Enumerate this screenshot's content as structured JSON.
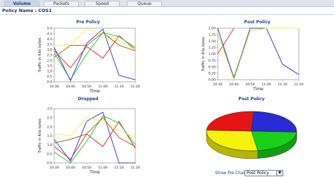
{
  "tabs": [
    {
      "label": "Volume",
      "active": true
    },
    {
      "label": "Packets",
      "active": false
    },
    {
      "label": "Speed",
      "active": false
    },
    {
      "label": "Queue",
      "active": false
    }
  ],
  "policy_name": "Policy Name : COS1",
  "pie_controls": {
    "label": "Show Pie Chart :",
    "selected": "Post Policy"
  },
  "colors": {
    "s1": "#e03030",
    "s2": "#2bcc2b",
    "s3": "#3d3dcf",
    "s4": "#f2f24a",
    "s5": "#a6602a",
    "title": "#1f3f8a"
  },
  "chart_data": [
    {
      "type": "line",
      "title": "Pre Policy",
      "xlabel": "Time",
      "ylabel": "Traffic in Kilo bytes",
      "categories": [
        "10:30",
        "10:40",
        "10:50",
        "11:00",
        "11:10",
        "11:20"
      ],
      "ylim": [
        0,
        5.0
      ],
      "yticks": [
        "0.0",
        "0.5",
        "1.0",
        "1.5",
        "2.0",
        "2.5",
        "3.0",
        "3.5",
        "4.0",
        "4.5",
        "5.0"
      ],
      "series": [
        {
          "values": [
            2.9,
            1.3,
            3.3,
            2.2,
            4.3,
            3.0
          ]
        },
        {
          "values": [
            2.7,
            0.2,
            2.6,
            4.6,
            4.2,
            3.2
          ]
        },
        {
          "values": [
            3.2,
            0.1,
            3.6,
            4.9,
            0.6,
            0.2
          ]
        },
        {
          "values": [
            3.3,
            3.5,
            4.9,
            4.4,
            3.9,
            3.0
          ]
        },
        {
          "values": [
            2.3,
            3.4,
            3.4,
            4.6,
            3.4,
            2.9
          ]
        }
      ]
    },
    {
      "type": "line",
      "title": "Post Policy",
      "xlabel": "Time",
      "ylabel": "Traffic in Kilo bytes",
      "categories": [
        "10:30",
        "10:40",
        "10:50",
        "11:00",
        "11:10",
        "11:20"
      ],
      "ylim": [
        0,
        2.0
      ],
      "yticks": [
        "0.00",
        "0.25",
        "0.50",
        "0.75",
        "1.00",
        "1.25",
        "1.50",
        "1.75",
        "2.00"
      ],
      "series": [
        {
          "values": [
            1.0,
            2.0,
            null,
            null,
            null,
            null
          ]
        },
        {
          "values": [
            1.8,
            0.1,
            1.9,
            2.0,
            2.0,
            2.0
          ]
        },
        {
          "values": [
            2.0,
            0.05,
            2.0,
            2.0,
            0.6,
            0.2
          ]
        },
        {
          "values": [
            1.8,
            0.0,
            1.9,
            2.0,
            2.0,
            2.0
          ]
        }
      ]
    },
    {
      "type": "line",
      "title": "Dropped",
      "xlabel": "Time",
      "ylabel": "Traffic in Kilo bytes",
      "categories": [
        "10:30",
        "10:40",
        "10:50",
        "11:00",
        "11:10",
        "11:20"
      ],
      "ylim": [
        0,
        3.0
      ],
      "yticks": [
        "0.0",
        "0.5",
        "1.0",
        "1.5",
        "2.0",
        "2.5",
        "3.0"
      ],
      "series": [
        {
          "values": [
            0.9,
            0.2,
            1.6,
            0.9,
            2.3,
            0.8
          ]
        },
        {
          "values": [
            0.6,
            0.0,
            1.2,
            2.6,
            2.2,
            1.0
          ]
        },
        {
          "values": [
            1.3,
            0.1,
            2.3,
            2.8,
            0.0,
            0.0
          ]
        },
        {
          "values": [
            1.6,
            1.5,
            2.5,
            2.3,
            1.8,
            1.4
          ]
        },
        {
          "values": [
            1.1,
            1.3,
            1.6,
            2.5,
            1.4,
            0.9
          ]
        }
      ]
    },
    {
      "type": "pie",
      "title": "Post Policy",
      "slices": [
        {
          "value": 25,
          "color": "#2a2ad6"
        },
        {
          "value": 22,
          "color": "#18d218"
        },
        {
          "value": 28,
          "color": "#f2f20c"
        },
        {
          "value": 25,
          "color": "#e61414"
        }
      ]
    }
  ]
}
